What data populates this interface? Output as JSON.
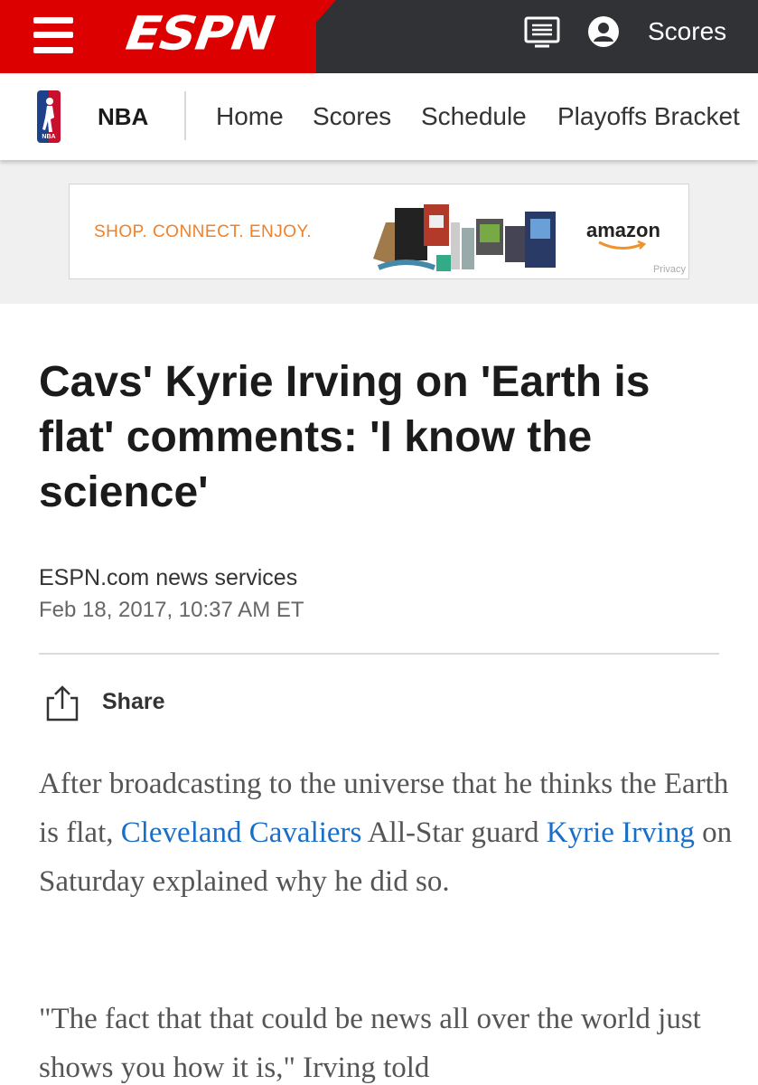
{
  "header": {
    "logo_text": "ESPN",
    "scores_label": "Scores",
    "icons": [
      "menu-icon",
      "tv-guide-icon",
      "user-icon"
    ],
    "colors": {
      "brand_red": "#dd0000",
      "bar_dark": "#313236"
    }
  },
  "nav": {
    "league": "NBA",
    "items": [
      {
        "label": "Home"
      },
      {
        "label": "Scores"
      },
      {
        "label": "Schedule"
      },
      {
        "label": "Playoffs Bracket"
      }
    ]
  },
  "ad": {
    "tagline": "SHOP. CONNECT. ENJOY.",
    "brand": "amazon",
    "privacy": "Privacy"
  },
  "article": {
    "headline": "Cavs' Kyrie Irving on 'Earth is flat' comments: 'I know the science'",
    "byline": "ESPN.com news services",
    "date": "Feb 18, 2017, 10:37 AM ET",
    "share_label": "Share",
    "p1": {
      "t1": "After broadcasting to the universe that he thinks the Earth is flat, ",
      "link1": "Cleveland Cavaliers",
      "t2": " All-Star guard ",
      "link2": "Kyrie Irving",
      "t3": " on Saturday explained why he did so."
    },
    "p2": "\"The fact that that could be news all over the world just shows you how it is,\" Irving told",
    "link_color": "#1a6ec8"
  }
}
